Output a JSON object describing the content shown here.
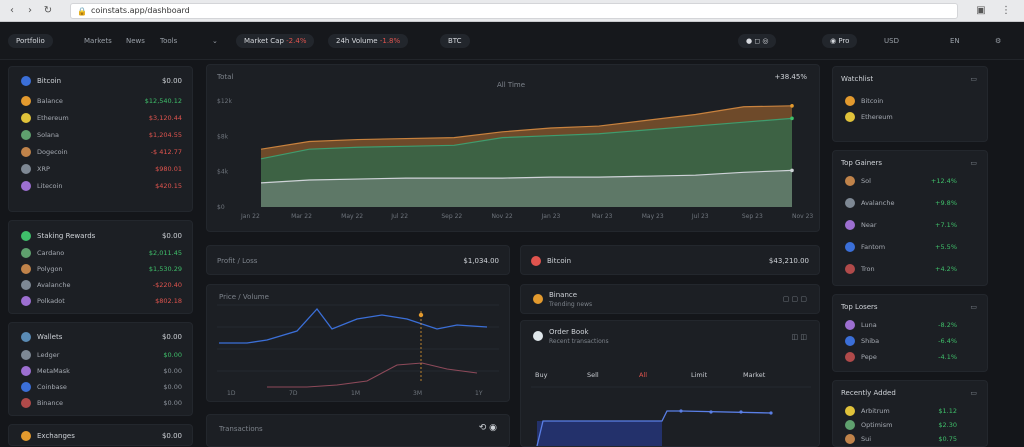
{
  "browser": {
    "url": "coinstats.app/dashboard"
  },
  "nav": {
    "brand": "Portfolio",
    "items": [
      "Markets",
      "News",
      "Tools"
    ],
    "ticker_a_label": "Market Cap",
    "ticker_a_change": "-2.4%",
    "ticker_b_label": "24h Volume",
    "ticker_b_change": "-1.8%",
    "ticker_c_label": "BTC",
    "account": "Pro",
    "currency": "USD",
    "language": "EN"
  },
  "left_holdings": {
    "title": "Bitcoin",
    "title_value": "$0.00",
    "rows": [
      {
        "label": "Balance",
        "value": "$12,540.12",
        "color": "green"
      },
      {
        "label": "Ethereum",
        "value": "$3,120.44",
        "color": "red"
      },
      {
        "label": "Solana",
        "value": "$1,204.55",
        "color": "red"
      },
      {
        "label": "Dogecoin",
        "value": "-$ 412.77",
        "color": "red"
      },
      {
        "label": "XRP",
        "value": "$980.01",
        "color": "red"
      },
      {
        "label": "Litecoin",
        "value": "$420.15",
        "color": "red"
      }
    ]
  },
  "left_defi": {
    "title": "Staking Rewards",
    "title_value": "$0.00",
    "rows": [
      {
        "label": "Cardano",
        "value": "$2,011.45",
        "color": "green"
      },
      {
        "label": "Polygon",
        "value": "$1,530.29",
        "color": "green"
      },
      {
        "label": "Avalanche",
        "value": "-$220.40",
        "color": "red"
      },
      {
        "label": "Polkadot",
        "value": "$802.18",
        "color": "red"
      }
    ]
  },
  "left_wallets": {
    "title": "Wallets",
    "title_value": "$0.00",
    "rows": [
      {
        "label": "Ledger",
        "value": "$0.00",
        "color": "green"
      },
      {
        "label": "MetaMask",
        "value": "$0.00",
        "color": "muted"
      },
      {
        "label": "Coinbase",
        "value": "$0.00",
        "color": "muted"
      },
      {
        "label": "Binance",
        "value": "$0.00",
        "color": "muted"
      }
    ]
  },
  "left_bottom": {
    "label": "Exchanges",
    "value": "$0.00"
  },
  "main_chart": {
    "title": "Total",
    "center_label": "All Time",
    "value": "+38.45%",
    "yticks": [
      "$12k",
      "$8k",
      "$4k",
      "$0"
    ],
    "xticks": [
      "Jan 22",
      "Mar 22",
      "May 22",
      "Jul 22",
      "Sep 22",
      "Nov 22",
      "Jan 23",
      "Mar 23",
      "May 23",
      "Jul 23",
      "Sep 23",
      "Nov 23"
    ]
  },
  "chart_data": {
    "type": "area",
    "x": [
      0,
      1,
      2,
      3,
      4,
      5,
      6,
      7,
      8,
      9,
      10,
      11
    ],
    "series": [
      {
        "name": "",
        "color": "#8a5a2c",
        "values": [
          0.6,
          0.68,
          0.7,
          0.71,
          0.72,
          0.78,
          0.82,
          0.84,
          0.9,
          0.96,
          1.04,
          1.05
        ]
      },
      {
        "name": "",
        "color": "#2e6b4e",
        "values": [
          0.5,
          0.6,
          0.62,
          0.63,
          0.64,
          0.72,
          0.74,
          0.76,
          0.8,
          0.84,
          0.88,
          0.92
        ]
      },
      {
        "name": "",
        "color": "#9ea3aa",
        "values": [
          0.25,
          0.28,
          0.29,
          0.3,
          0.3,
          0.3,
          0.31,
          0.31,
          0.32,
          0.33,
          0.36,
          0.38
        ]
      }
    ]
  },
  "stats_row": {
    "left_label": "Profit / Loss",
    "left_value": "$1,034.00",
    "right_label": "Bitcoin",
    "right_value": "$43,210.00"
  },
  "line_panel": {
    "legend": "Price / Volume",
    "xlabels": [
      "1D",
      "7D",
      "1M",
      "3M",
      "1Y"
    ]
  },
  "news_panel": {
    "title": "Binance",
    "subtitle": "Trending news"
  },
  "orders_panel": {
    "title": "Order Book",
    "subtitle": "Recent transactions",
    "tabs": [
      "Buy",
      "Sell",
      "All",
      "Limit",
      "Market"
    ]
  },
  "bottom_left": {
    "label": "Transactions"
  },
  "right_watch": {
    "title": "Watchlist",
    "rows": [
      {
        "label": "Bitcoin"
      },
      {
        "label": "Ethereum"
      }
    ]
  },
  "right_movers": {
    "title": "Top Gainers",
    "rows": [
      {
        "label": "Sol",
        "value": "+12.4%"
      },
      {
        "label": "Avalanche",
        "value": "+9.8%"
      },
      {
        "label": "Near",
        "value": "+7.1%"
      },
      {
        "label": "Fantom",
        "value": "+5.5%"
      },
      {
        "label": "Tron",
        "value": "+4.2%"
      }
    ]
  },
  "right_losers": {
    "title": "Top Losers",
    "rows": [
      {
        "label": "Luna",
        "value": "-8.2%"
      },
      {
        "label": "Shiba",
        "value": "-6.4%"
      },
      {
        "label": "Pepe",
        "value": "-4.1%"
      }
    ]
  },
  "right_bottom": {
    "title": "Recently Added",
    "rows": [
      {
        "label": "Arbitrum",
        "value": "$1.12"
      },
      {
        "label": "Optimism",
        "value": "$2.30"
      },
      {
        "label": "Sui",
        "value": "$0.75"
      }
    ]
  }
}
